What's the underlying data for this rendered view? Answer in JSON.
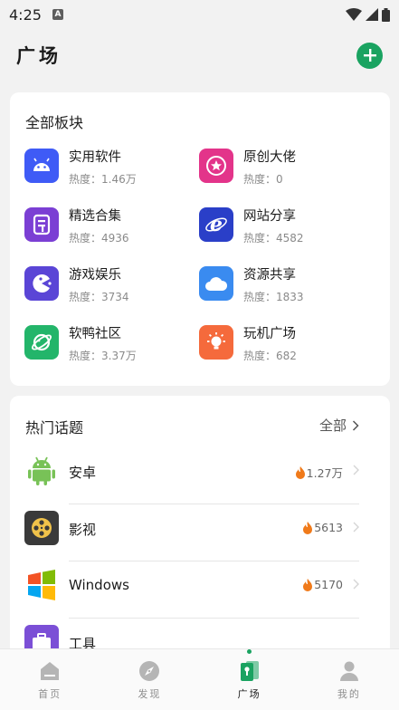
{
  "status": {
    "time": "4:25",
    "badge": "A"
  },
  "header": {
    "title": "广场"
  },
  "boards": {
    "title": "全部板块",
    "items": [
      {
        "name": "实用软件",
        "heat": "热度：1.46万",
        "color": "#3f5bf6",
        "icon": "android-icon"
      },
      {
        "name": "原创大佬",
        "heat": "热度：0",
        "color": "#e3348a",
        "icon": "star-badge-icon"
      },
      {
        "name": "精选合集",
        "heat": "热度：4936",
        "color": "#7b3fd4",
        "icon": "collection-icon"
      },
      {
        "name": "网站分享",
        "heat": "热度：4582",
        "color": "#2a3fc8",
        "icon": "ie-icon"
      },
      {
        "name": "游戏娱乐",
        "heat": "热度：3734",
        "color": "#5a45d6",
        "icon": "pacman-icon"
      },
      {
        "name": "资源共享",
        "heat": "热度：1833",
        "color": "#3a8bf0",
        "icon": "cloud-icon"
      },
      {
        "name": "软鸭社区",
        "heat": "热度：3.37万",
        "color": "#23b56a",
        "icon": "planet-icon"
      },
      {
        "name": "玩机广场",
        "heat": "热度：682",
        "color": "#f56a3c",
        "icon": "bulb-icon"
      }
    ]
  },
  "topics": {
    "title": "热门话题",
    "all_label": "全部",
    "items": [
      {
        "name": "安卓",
        "heat": "1.27万"
      },
      {
        "name": "影视",
        "heat": "5613"
      },
      {
        "name": "Windows",
        "heat": "5170"
      },
      {
        "name": "工具",
        "heat": ""
      }
    ]
  },
  "nav": {
    "items": [
      {
        "label": "首页"
      },
      {
        "label": "发现"
      },
      {
        "label": "广场"
      },
      {
        "label": "我的"
      }
    ]
  },
  "colors": {
    "accent": "#1aa361",
    "background": "#f2f2f2"
  }
}
